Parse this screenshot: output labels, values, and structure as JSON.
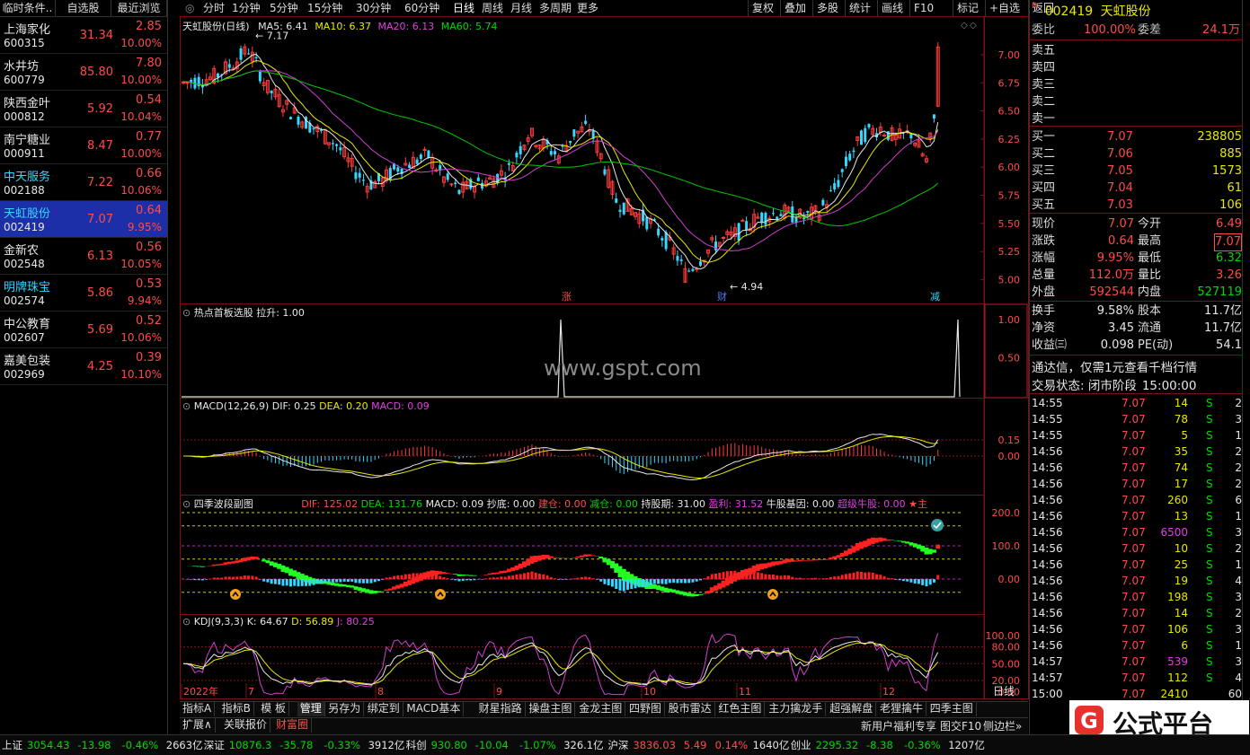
{
  "left_header": [
    "临时条件..",
    "自选股",
    "最近浏览"
  ],
  "stocks": [
    {
      "name": "上海家化",
      "code": "600315",
      "price": "31.34",
      "chg": "2.85",
      "pct": "10.00%"
    },
    {
      "name": "水井坊",
      "code": "600779",
      "price": "85.80",
      "chg": "7.80",
      "pct": "10.00%"
    },
    {
      "name": "陕西金叶",
      "code": "000812",
      "price": "5.92",
      "chg": "0.54",
      "pct": "10.04%"
    },
    {
      "name": "南宁糖业",
      "code": "000911",
      "price": "8.47",
      "chg": "0.77",
      "pct": "10.00%"
    },
    {
      "name": "中天服务",
      "code": "002188",
      "price": "7.22",
      "chg": "0.66",
      "pct": "10.06%"
    },
    {
      "name": "天虹股份",
      "code": "002419",
      "price": "7.07",
      "chg": "0.64",
      "pct": "9.95%"
    },
    {
      "name": "金新农",
      "code": "002548",
      "price": "6.13",
      "chg": "0.56",
      "pct": "10.05%"
    },
    {
      "name": "明牌珠宝",
      "code": "002574",
      "price": "5.86",
      "chg": "0.53",
      "pct": "9.94%"
    },
    {
      "name": "中公教育",
      "code": "002607",
      "price": "5.69",
      "chg": "0.52",
      "pct": "10.06%"
    },
    {
      "name": "嘉美包装",
      "code": "002969",
      "price": "4.25",
      "chg": "0.39",
      "pct": "10.10%"
    }
  ],
  "toolbar": {
    "periods": [
      "分时",
      "1分钟",
      "5分钟",
      "15分钟",
      "30分钟",
      "60分钟",
      "日线",
      "周线",
      "月线",
      "多周期",
      "更多"
    ],
    "actions": [
      "复权",
      "叠加",
      "多股",
      "统计",
      "画线",
      "F10",
      "标记",
      "+自选",
      "返回"
    ]
  },
  "main_chart": {
    "title": "天虹股份(日线)",
    "ma5": "MA5: 6.41",
    "ma10": "MA10: 6.37",
    "ma20": "MA20: 6.13",
    "ma60": "MA60: 5.74",
    "y_ticks": [
      "7.00",
      "6.75",
      "6.50",
      "6.25",
      "6.00",
      "5.75",
      "5.50",
      "5.25",
      "5.00"
    ],
    "high_label": "7.17",
    "low_label": "4.94",
    "markers": [
      "涨",
      "财",
      "减"
    ]
  },
  "panel2": {
    "title": "热点首板选股",
    "value": "拉升: 1.00",
    "y_ticks": [
      "1.00",
      "0.50"
    ]
  },
  "watermark": "www.gspt.com",
  "macd": {
    "title": "MACD(12,26,9)",
    "dif": "DIF: 0.25",
    "dea": "DEA: 0.20",
    "macd": "MACD: 0.09",
    "y_ticks": [
      "0.15",
      "0.00"
    ]
  },
  "wave": {
    "title": "四季波段副图",
    "dif": "DIF: 125.02",
    "dea": "DEA: 131.76",
    "macd": "MACD: 0.09",
    "chaodi": "抄底: 0.00",
    "jiancang": "建仓: 0.00",
    "jiancang2": "减仓: 0.00",
    "chigu": "持股期: 31.00",
    "yingli": "盈利: 31.52",
    "niugu": "牛股基因: 0.00",
    "chaoji": "超级牛股: 0.00",
    "star": "★主",
    "y_ticks": [
      "200.0",
      "100.0",
      "0.00"
    ]
  },
  "kdj": {
    "title": "KDJ(9,3,3)",
    "k": "K: 64.67",
    "d": "D: 56.89",
    "j": "J: 80.25",
    "y_ticks": [
      "100.00",
      "80.00",
      "50.00",
      "20.00",
      "0.00"
    ]
  },
  "date_axis": [
    "2022年",
    "7",
    "8",
    "9",
    "10",
    "11",
    "12"
  ],
  "period_label": "日线",
  "bottom_tabs": [
    "指标A",
    "指标B",
    "模 板",
    "管理",
    "另存为",
    "绑定到",
    "MACD基本",
    "财星指路",
    "操盘主图",
    "金龙主图",
    "四野图",
    "股市雷达",
    "红色主图",
    "主力擒龙手",
    "超强解盘",
    "老狸擒牛",
    "四季主图"
  ],
  "bottom_tabs2": [
    "扩展∧",
    "关联报价",
    "财富圈"
  ],
  "bottom_right_text": "新用户福利专享",
  "bottom_right_text2": "图交F10",
  "bottom_right_text3": "侧边栏»",
  "quote": {
    "code": "002419",
    "name": "天虹股份",
    "weibi_label": "委比",
    "weibi": "100.00%",
    "weicha_label": "委差",
    "weicha": "24.1万",
    "asks": [
      {
        "label": "卖五"
      },
      {
        "label": "卖四"
      },
      {
        "label": "卖三"
      },
      {
        "label": "卖二"
      },
      {
        "label": "卖一"
      }
    ],
    "bids": [
      {
        "label": "买一",
        "price": "7.07",
        "vol": "238805"
      },
      {
        "label": "买二",
        "price": "7.06",
        "vol": "885"
      },
      {
        "label": "买三",
        "price": "7.05",
        "vol": "1573"
      },
      {
        "label": "买四",
        "price": "7.04",
        "vol": "61"
      },
      {
        "label": "买五",
        "price": "7.03",
        "vol": "106"
      }
    ],
    "stats": [
      {
        "l1": "现价",
        "v1": "7.07",
        "l2": "今开",
        "v2": "6.49"
      },
      {
        "l1": "涨跌",
        "v1": "0.64",
        "l2": "最高",
        "v2": "7.07"
      },
      {
        "l1": "涨幅",
        "v1": "9.95%",
        "l2": "最低",
        "v2": "6.32"
      },
      {
        "l1": "总量",
        "v1": "112.0万",
        "l2": "量比",
        "v2": "3.26"
      },
      {
        "l1": "外盘",
        "v1": "592544",
        "l2": "内盘",
        "v2": "527119"
      }
    ],
    "stats2": [
      {
        "l1": "换手",
        "v1": "9.58%",
        "l2": "股本",
        "v2": "11.7亿"
      },
      {
        "l1": "净资",
        "v1": "3.45",
        "l2": "流通",
        "v2": "11.7亿"
      },
      {
        "l1": "收益㈢",
        "v1": "0.098",
        "l2": "PE(动)",
        "v2": "54.1"
      }
    ],
    "promo": "通达信，仅需1元查看千档行情",
    "status_label": "交易状态: 闭市阶段",
    "status_time": "15:00:00"
  },
  "ticks": [
    {
      "t": "14:55",
      "p": "7.07",
      "v": "14",
      "s": "S",
      "n": "2"
    },
    {
      "t": "14:55",
      "p": "7.07",
      "v": "78",
      "s": "S",
      "n": "3"
    },
    {
      "t": "14:55",
      "p": "7.07",
      "v": "5",
      "s": "S",
      "n": "1"
    },
    {
      "t": "14:56",
      "p": "7.07",
      "v": "35",
      "s": "S",
      "n": "2"
    },
    {
      "t": "14:56",
      "p": "7.07",
      "v": "74",
      "s": "S",
      "n": "2"
    },
    {
      "t": "14:56",
      "p": "7.07",
      "v": "17",
      "s": "S",
      "n": "2"
    },
    {
      "t": "14:56",
      "p": "7.07",
      "v": "260",
      "s": "S",
      "n": "6"
    },
    {
      "t": "14:56",
      "p": "7.07",
      "v": "13",
      "s": "S",
      "n": "1"
    },
    {
      "t": "14:56",
      "p": "7.07",
      "v": "6500",
      "s": "S",
      "n": "3"
    },
    {
      "t": "14:56",
      "p": "7.07",
      "v": "10",
      "s": "S",
      "n": "2"
    },
    {
      "t": "14:56",
      "p": "7.07",
      "v": "25",
      "s": "S",
      "n": "1"
    },
    {
      "t": "14:56",
      "p": "7.07",
      "v": "19",
      "s": "S",
      "n": "4"
    },
    {
      "t": "14:56",
      "p": "7.07",
      "v": "198",
      "s": "S",
      "n": "3"
    },
    {
      "t": "14:56",
      "p": "7.07",
      "v": "14",
      "s": "S",
      "n": "2"
    },
    {
      "t": "14:56",
      "p": "7.07",
      "v": "106",
      "s": "S",
      "n": "3"
    },
    {
      "t": "14:56",
      "p": "7.07",
      "v": "6",
      "s": "S",
      "n": "1"
    },
    {
      "t": "14:57",
      "p": "7.07",
      "v": "539",
      "s": "S",
      "n": "3"
    },
    {
      "t": "14:57",
      "p": "7.07",
      "v": "112",
      "s": "S",
      "n": "4"
    },
    {
      "t": "15:00",
      "p": "7.07",
      "v": "2410",
      "s": "",
      "n": "60"
    }
  ],
  "status_bar": [
    {
      "name": "上证",
      "val": "3054.43",
      "chg": "-13.98",
      "pct": "-0.46%",
      "amt": "2663亿"
    },
    {
      "name": "深证",
      "val": "10876.3",
      "chg": "-35.78",
      "pct": "-0.33%",
      "amt": "3912亿"
    },
    {
      "name": "科创",
      "val": "930.80",
      "chg": "-10.04",
      "pct": "-1.07%",
      "amt": "326.1亿"
    },
    {
      "name": "沪深",
      "val": "3836.03",
      "chg": "5.49",
      "pct": "0.14%",
      "amt": "1640亿"
    },
    {
      "name": "创业",
      "val": "2295.32",
      "chg": "-8.38",
      "pct": "-0.36%",
      "amt": "1207亿"
    }
  ],
  "logo_text": "公式平台"
}
